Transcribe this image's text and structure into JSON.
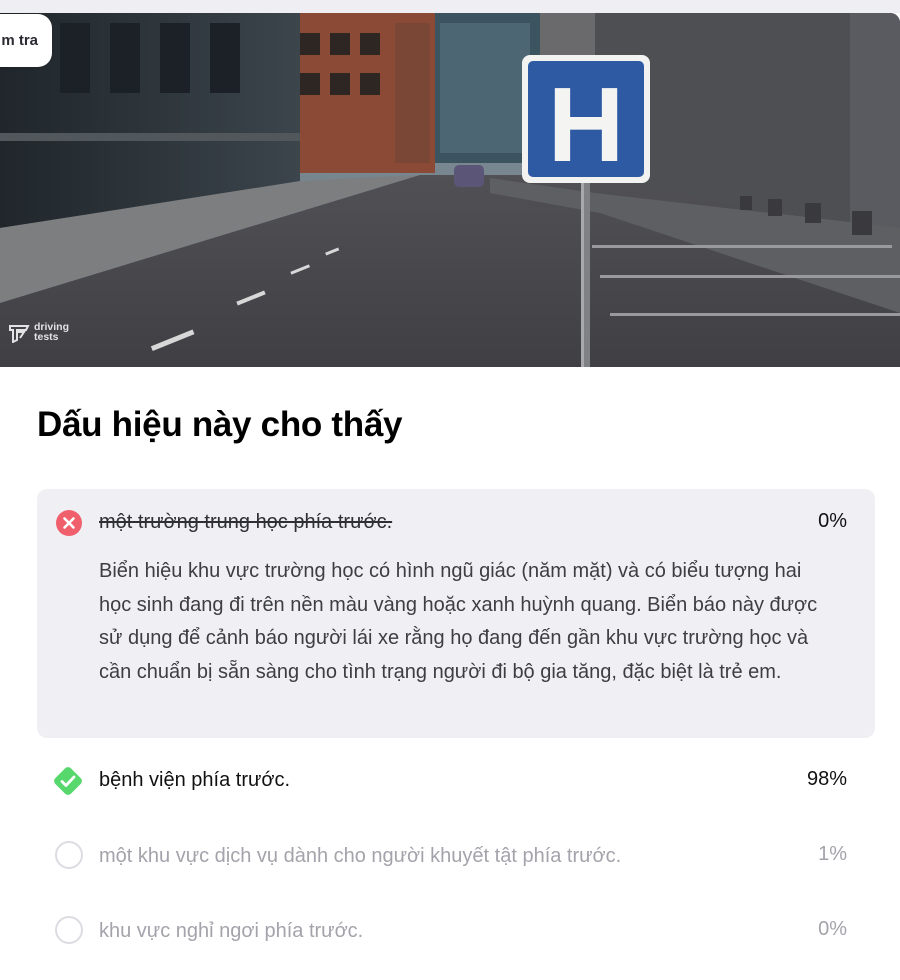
{
  "header": {
    "back_label": "m tra"
  },
  "scene": {
    "sign_letter": "H",
    "watermark": "driving\ntests"
  },
  "question": {
    "title": "Dấu hiệu này cho thấy"
  },
  "answers": [
    {
      "text": "một trường trung học phía trước.",
      "percent": "0%",
      "state": "wrong",
      "explanation": "Biển hiệu khu vực trường học có hình ngũ giác (năm mặt) và có biểu tượng hai học sinh đang đi trên nền màu vàng hoặc xanh huỳnh quang. Biển báo này được sử dụng để cảnh báo người lái xe rằng họ đang đến gần khu vực trường học và cần chuẩn bị sẵn sàng cho tình trạng người đi bộ gia tăng, đặc biệt là trẻ em."
    },
    {
      "text": "bệnh viện phía trước.",
      "percent": "98%",
      "state": "correct"
    },
    {
      "text": "một khu vực dịch vụ dành cho người khuyết tật phía trước.",
      "percent": "1%",
      "state": "unselected"
    },
    {
      "text": "khu vực nghỉ ngơi phía trước.",
      "percent": "0%",
      "state": "unselected"
    }
  ],
  "colors": {
    "wrong": "#f0606c",
    "correct": "#56d86d",
    "sign_blue": "#2e5aa3",
    "wrong_bg": "#f0f0f4",
    "muted_text": "#a3a3ab"
  },
  "icons": {
    "wrong": "x-circle-icon",
    "correct": "check-diamond-icon",
    "unselected": "radio-empty-icon"
  }
}
